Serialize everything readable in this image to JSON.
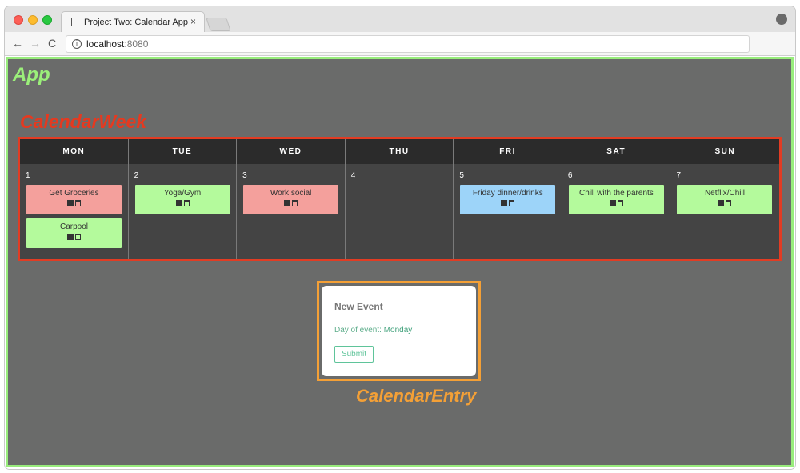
{
  "browser": {
    "tab_title": "Project Two: Calendar App",
    "tab_close": "×",
    "url_host": "localhost",
    "url_port": ":8080",
    "nav_back": "←",
    "nav_forward": "→",
    "nav_reload": "C",
    "info": "i",
    "star": "☆",
    "menu": "⋮"
  },
  "labels": {
    "app": "App",
    "week": "CalendarWeek",
    "entry": "CalendarEntry"
  },
  "colors": {
    "app_border": "#98ec7c",
    "week_border": "#e23c23",
    "entry_border": "#f4a036",
    "event_red": "#f4a09c",
    "event_green": "#b4fa9c",
    "event_blue": "#9dd4f9"
  },
  "week": {
    "days": [
      {
        "abbr": "MON",
        "num": "1",
        "events": [
          {
            "title": "Get Groceries",
            "color": "red"
          },
          {
            "title": "Carpool",
            "color": "green"
          }
        ]
      },
      {
        "abbr": "TUE",
        "num": "2",
        "events": [
          {
            "title": "Yoga/Gym",
            "color": "green"
          }
        ]
      },
      {
        "abbr": "WED",
        "num": "3",
        "events": [
          {
            "title": "Work social",
            "color": "red"
          }
        ]
      },
      {
        "abbr": "THU",
        "num": "4",
        "events": []
      },
      {
        "abbr": "FRI",
        "num": "5",
        "events": [
          {
            "title": "Friday dinner/drinks",
            "color": "blue"
          }
        ]
      },
      {
        "abbr": "SAT",
        "num": "6",
        "events": [
          {
            "title": "Chill with the parents",
            "color": "green"
          }
        ]
      },
      {
        "abbr": "SUN",
        "num": "7",
        "events": [
          {
            "title": "Netflix/Chill",
            "color": "green"
          }
        ]
      }
    ],
    "event_icons": [
      "edit-icon",
      "trash-icon"
    ]
  },
  "entry": {
    "placeholder": "New Event",
    "day_label": "Day of event:",
    "day_value": "Monday",
    "submit": "Submit"
  }
}
